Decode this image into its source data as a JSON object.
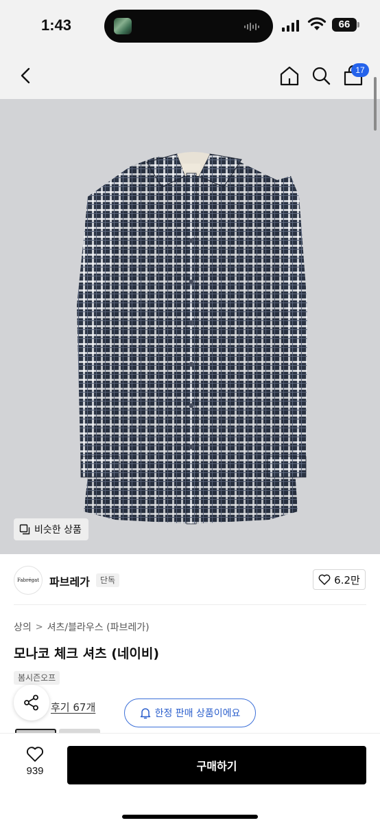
{
  "status_bar": {
    "time": "1:43",
    "battery": "66"
  },
  "nav": {
    "cart_count": "17",
    "icons": [
      "back-icon",
      "home-icon",
      "search-icon",
      "cart-icon"
    ]
  },
  "image": {
    "similar_button": "비슷한 상품",
    "subject": "navy check shirt"
  },
  "brand": {
    "logo_text": "Fabrégat",
    "name": "파브레가",
    "tag": "단독",
    "likes": "6.2만"
  },
  "product": {
    "breadcrumb": [
      "상의",
      "셔츠/블라우스 (파브레가)"
    ],
    "title": "모나코 체크 셔츠 (네이비)",
    "season_badge": "봄시즌오프",
    "reviews": "후기 67개",
    "limited_notice": "한정 판매 상품이에요"
  },
  "bottom_bar": {
    "wish_count": "939",
    "buy_label": "구매하기"
  },
  "colors": {
    "accent": "#2563eb",
    "pill_border": "#3b6fd8",
    "buy_bg": "#000000",
    "image_bg": "#d2d3d6",
    "shirt_navy": "#2b3444"
  }
}
